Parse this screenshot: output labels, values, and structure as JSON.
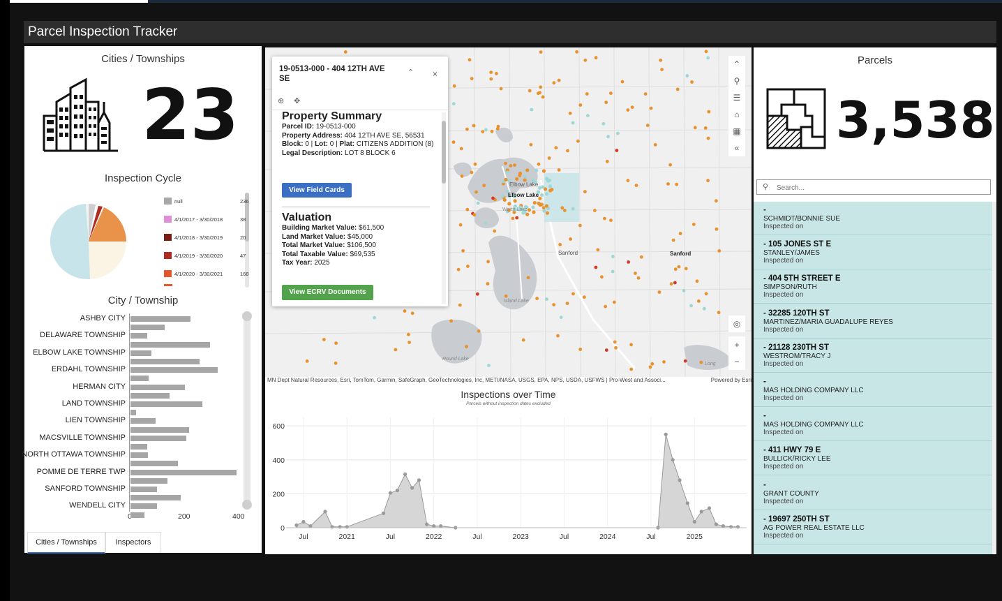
{
  "app": {
    "title": "Parcel Inspection Tracker"
  },
  "cities": {
    "title": "Cities / Townships",
    "count": "23",
    "icon": "city-buildings-icon"
  },
  "cycle": {
    "title": "Inspection Cycle",
    "legend": [
      {
        "label": "null",
        "count": "236",
        "color": "#a8a8a8"
      },
      {
        "label": "4/1/2017 - 3/30/2018",
        "count": "38",
        "color": "#e08fd6"
      },
      {
        "label": "4/1/2018 - 3/30/2019",
        "count": "20",
        "color": "#7a1d12"
      },
      {
        "label": "4/1/2019 - 3/30/2020",
        "count": "47",
        "color": "#b02a22"
      },
      {
        "label": "4/1/2020 - 3/30/2021",
        "count": "168",
        "color": "#e2582b"
      }
    ]
  },
  "city_chart": {
    "title": "City / Township",
    "labels": [
      "ASHBY CITY",
      "DELAWARE TOWNSHIP",
      "ELBOW LAKE TOWNSHIP",
      "ERDAHL TOWNSHIP",
      "HERMAN CITY",
      "LAND TOWNSHIP",
      "LIEN TOWNSHIP",
      "MACSVILLE TOWNSHIP",
      "NORTH OTTAWA TOWNSHIP",
      "POMME DE TERRE TWP",
      "SANFORD TOWNSHIP",
      "WENDELL CITY"
    ],
    "ticks": [
      "0",
      "200",
      "400"
    ]
  },
  "tabs": {
    "cities": "Cities / Townships",
    "inspectors": "Inspectors"
  },
  "popup": {
    "title": "19-0513-000 - 404 12TH AVE SE",
    "summary_heading": "Property Summary",
    "parcel_id_label": "Parcel ID:",
    "parcel_id": "19-0513-000",
    "address_label": "Property Address:",
    "address": "404 12TH AVE SE, 56531",
    "block_label": "Block:",
    "block": "0",
    "lot_label": "Lot:",
    "lot": "0",
    "plat_label": "Plat:",
    "plat": "CITIZENS ADDITION (8)",
    "legal_label": "Legal Description:",
    "legal": "LOT 8 BLOCK 6",
    "field_cards_button": "View Field Cards",
    "valuation_heading": "Valuation",
    "bmv_label": "Building Market Value:",
    "bmv": "$61,500",
    "lmv_label": "Land Market Value:",
    "lmv": "$45,000",
    "tmv_label": "Total Market Value:",
    "tmv": "$106,500",
    "ttv_label": "Total Taxable Value:",
    "ttv": "$69,535",
    "year_label": "Tax Year:",
    "year": "2025",
    "ecrv_button": "View ECRV Documents",
    "button_color_blue": "#3a6fc4",
    "button_color_green": "#52a34b"
  },
  "map": {
    "labels": {
      "elbow1": "Elbow Lake",
      "elbow2": "Elbow Lake",
      "worth": "Worth Lake",
      "sanford1": "Sanford",
      "sanford2": "Sanford",
      "island": "Island Lake",
      "round": "Round Lake",
      "long": "Long"
    },
    "attribution": "MN Dept Natural Resources, Esri, TomTom, Garmin, SafeGraph, GeoTechnologies, Inc, METI/NASA, USGS, EPA, NPS, USDA, USFWS | Pro-West and Associ...",
    "powered": "Powered by Esri",
    "point_color": "#e8922e",
    "point_color_red": "#d33a2a",
    "point_color_teal": "#9fd6d6"
  },
  "time_chart": {
    "title": "Inspections over Time",
    "subtitle": "Parcels without inspection dates excluded"
  },
  "chart_data": {
    "type": "area",
    "title": "Inspections over Time",
    "subtitle": "Parcels without inspection dates excluded",
    "xlabel": "",
    "ylabel": "",
    "ylim": [
      0,
      650
    ],
    "x_ticks": [
      "Jul",
      "2021",
      "Jul",
      "2022",
      "Jul",
      "2023",
      "Jul",
      "2024",
      "Jul",
      "2025"
    ],
    "y_ticks": [
      "0",
      "200",
      "400",
      "600"
    ],
    "x": [
      2020.42,
      2020.5,
      2020.58,
      2020.75,
      2020.83,
      2020.92,
      2021.0,
      2021.42,
      2021.5,
      2021.58,
      2021.67,
      2021.75,
      2021.83,
      2021.92,
      2022.0,
      2022.08,
      2022.25,
      2024.58,
      2024.67,
      2024.75,
      2024.83,
      2024.92,
      2025.0,
      2025.08,
      2025.17,
      2025.25,
      2025.33,
      2025.42,
      2025.5
    ],
    "values": [
      15,
      35,
      10,
      95,
      5,
      5,
      5,
      85,
      205,
      220,
      315,
      235,
      280,
      20,
      10,
      10,
      0,
      0,
      550,
      400,
      280,
      145,
      35,
      95,
      115,
      20,
      10,
      5,
      5
    ],
    "grid": true
  },
  "parcels": {
    "title": "Parcels",
    "count": "3,538",
    "search_placeholder": "Search...",
    "list_bg": "#c8e6e6",
    "items": [
      {
        "addr": "-",
        "owner": "SCHMIDT/BONNIE SUE",
        "insp": "Inspected on"
      },
      {
        "addr": "- 105 JONES ST E",
        "owner": "STANLEY/JAMES",
        "insp": "Inspected on"
      },
      {
        "addr": "- 404 5TH STREET E",
        "owner": "SIMPSON/RUTH",
        "insp": "Inspected on"
      },
      {
        "addr": "- 32285 120TH ST",
        "owner": "MARTINEZ/MARIA GUADALUPE REYES",
        "insp": "Inspected on"
      },
      {
        "addr": "- 21128 230TH ST",
        "owner": "WESTROM/TRACY J",
        "insp": "Inspected on"
      },
      {
        "addr": "-",
        "owner": "MAS HOLDING COMPANY LLC",
        "insp": "Inspected on"
      },
      {
        "addr": "-",
        "owner": "MAS HOLDING COMPANY LLC",
        "insp": "Inspected on"
      },
      {
        "addr": "- 411 HWY 79 E",
        "owner": "BULLICK/RICKY LEE",
        "insp": "Inspected on"
      },
      {
        "addr": "-",
        "owner": "GRANT COUNTY",
        "insp": "Inspected on"
      },
      {
        "addr": "- 19697 250TH ST",
        "owner": "AG POWER REAL ESTATE LLC",
        "insp": "Inspected on"
      }
    ]
  }
}
